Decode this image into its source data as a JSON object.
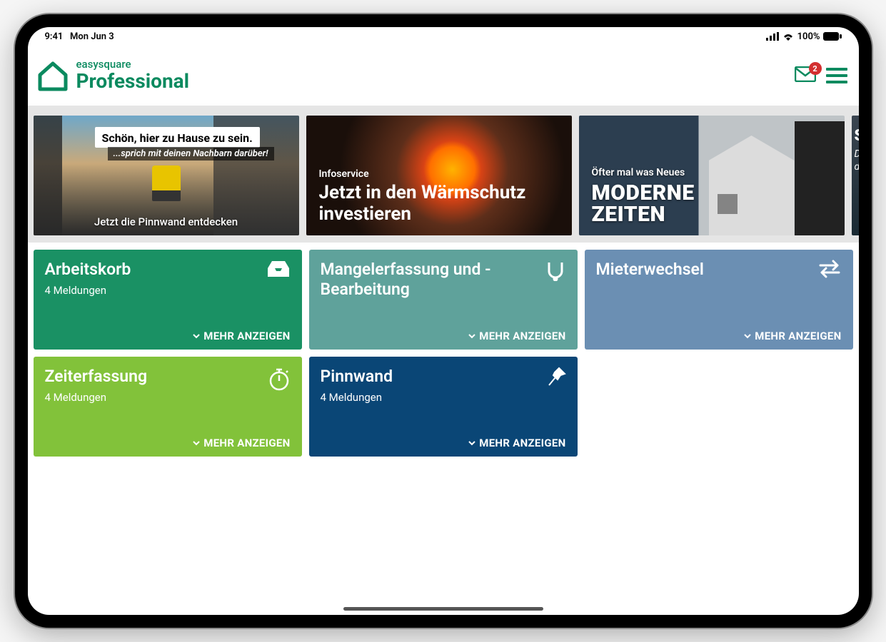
{
  "status": {
    "time": "9:41",
    "date": "Mon Jun 3",
    "battery_pct": "100%"
  },
  "header": {
    "logo_top": "easysquare",
    "logo_bottom": "Professional",
    "mail_badge": "2"
  },
  "banners": [
    {
      "speech": "Schön, hier zu Hause zu sein.",
      "speech_sub": "...sprich mit deinen Nachbarn darüber!",
      "caption": "Jetzt die Pinnwand entdecken"
    },
    {
      "category": "Infoservice",
      "headline": "Jetzt in den Wärmschutz investieren"
    },
    {
      "category": "Öfter mal was Neues",
      "headline_line1": "MODERNE",
      "headline_line2": "ZEITEN"
    },
    {
      "peek1": "S",
      "peek2": "Di",
      "peek3": "di"
    }
  ],
  "more_label": "MEHR ANZEIGEN",
  "tiles": [
    {
      "title": "Arbeitskorb",
      "subtitle": "4 Meldungen"
    },
    {
      "title": "Mangelerfassung und -Bearbeitung",
      "subtitle": ""
    },
    {
      "title": "Mieterwechsel",
      "subtitle": ""
    },
    {
      "title": "Zeiterfassung",
      "subtitle": "4 Meldungen"
    },
    {
      "title": "Pinnwand",
      "subtitle": "4 Meldungen"
    }
  ],
  "colors": {
    "brand": "#0b8a5f",
    "tile_green": "#1a9164",
    "tile_teal": "#5fa29b",
    "tile_blue": "#6b8fb3",
    "tile_lime": "#82c23a",
    "tile_navy": "#0a4676",
    "badge_red": "#d32f2f"
  }
}
